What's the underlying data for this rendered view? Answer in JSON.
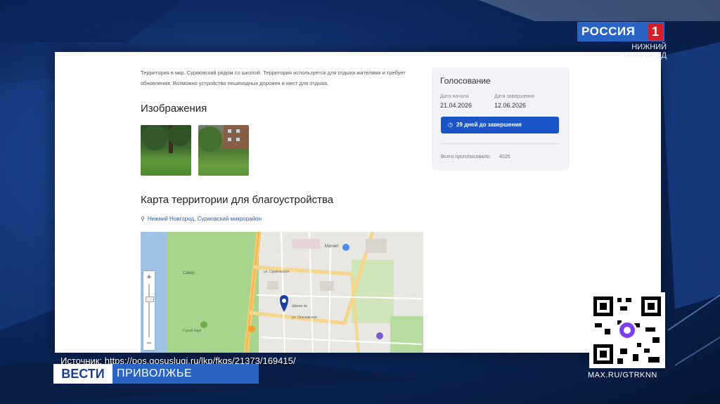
{
  "description": "Территория в мкр. Сурмовский рядом со школой. Территория используется для отдыха жителями и требует обновления. Возможно устройство пешеходных дорожек и мест для отдыха.",
  "images_title": "Изображения",
  "map_title": "Карта территории для благоустройства",
  "address": "Нижний Новгород, Сурмовский микрорайон",
  "vote": {
    "title": "Голосование",
    "start_label": "Дата начала",
    "start_value": "21.04.2026",
    "end_label": "Дата завершения",
    "end_value": "12.06.2026",
    "button": "29 дней до завершения",
    "total_label": "Всего проголосовало:",
    "total_value": "4025"
  },
  "map_labels": {
    "street1": "ул. Сурмовская",
    "street2": "ул. Ольховская",
    "poi1": "Магнит",
    "poi2": "Школа №",
    "poi3": "Сквер",
    "poi4": "Сухой парк",
    "zoom_in": "+",
    "zoom_out": "−"
  },
  "tv": {
    "channel": "РОССИЯ",
    "channel_num": "1",
    "city": "НИЖНИЙ НОВГОРОД",
    "source": "Источник: https://pos.gosuslugi.ru/lkp/fkgs/21373/169415/",
    "vesti": "ВЕСТИ",
    "region": "ПРИВОЛЖЬЕ",
    "qr_caption": "MAX.RU/GTRKNN"
  },
  "colors": {
    "accent": "#1a55c8",
    "brand": "#2a64c5",
    "red": "#d51f2a"
  }
}
